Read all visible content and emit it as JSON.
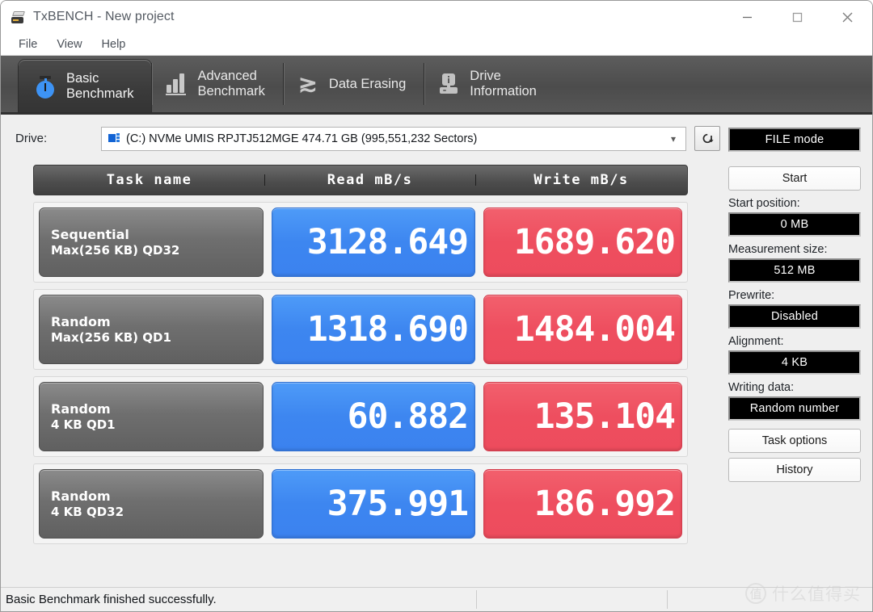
{
  "window": {
    "title": "TxBENCH - New project",
    "icon": "drive-icon",
    "controls": {
      "minimize": "minimize-icon",
      "maximize": "maximize-icon",
      "close": "close-icon"
    }
  },
  "menu": {
    "items": [
      "File",
      "View",
      "Help"
    ]
  },
  "tabs": [
    {
      "label": "Basic\nBenchmark",
      "icon": "stopwatch-icon",
      "active": true
    },
    {
      "label": "Advanced\nBenchmark",
      "icon": "bar-chart-icon",
      "active": false
    },
    {
      "label": "Data Erasing",
      "icon": "zigzag-erase-icon",
      "active": false
    },
    {
      "label": "Drive\nInformation",
      "icon": "drive-info-icon",
      "active": false
    }
  ],
  "drive": {
    "label": "Drive:",
    "selected": "(C:) NVMe UMIS RPJTJ512MGE  474.71 GB (995,551,232 Sectors)",
    "caret": "chevron-down-icon",
    "refresh_icon": "refresh-icon"
  },
  "table": {
    "headers": {
      "task": "Task name",
      "read": "Read mB/s",
      "write": "Write mB/s"
    },
    "rows": [
      {
        "name_line1": "Sequential",
        "name_line2": "Max(256 KB) QD32",
        "read": "3128.649",
        "write": "1689.620"
      },
      {
        "name_line1": "Random",
        "name_line2": "Max(256 KB) QD1",
        "read": "1318.690",
        "write": "1484.004"
      },
      {
        "name_line1": "Random",
        "name_line2": "4 KB QD1",
        "read": "60.882",
        "write": "135.104"
      },
      {
        "name_line1": "Random",
        "name_line2": "4 KB QD32",
        "read": "375.991",
        "write": "186.992"
      }
    ]
  },
  "sidebar": {
    "mode": "FILE mode",
    "start": "Start",
    "start_position_label": "Start position:",
    "start_position_value": "0 MB",
    "measurement_size_label": "Measurement size:",
    "measurement_size_value": "512 MB",
    "prewrite_label": "Prewrite:",
    "prewrite_value": "Disabled",
    "alignment_label": "Alignment:",
    "alignment_value": "4 KB",
    "writing_data_label": "Writing data:",
    "writing_data_value": "Random number",
    "task_options": "Task options",
    "history": "History"
  },
  "status": {
    "message": "Basic Benchmark finished successfully."
  },
  "watermark": {
    "mark": "值",
    "text": "什么值得买"
  },
  "colors": {
    "read_accent": "#3d86f0",
    "write_accent": "#ee4e5f",
    "tab_bar": "#4c4c4c",
    "panel_bg": "#efefef",
    "task_cell": "#6f6f6f"
  }
}
